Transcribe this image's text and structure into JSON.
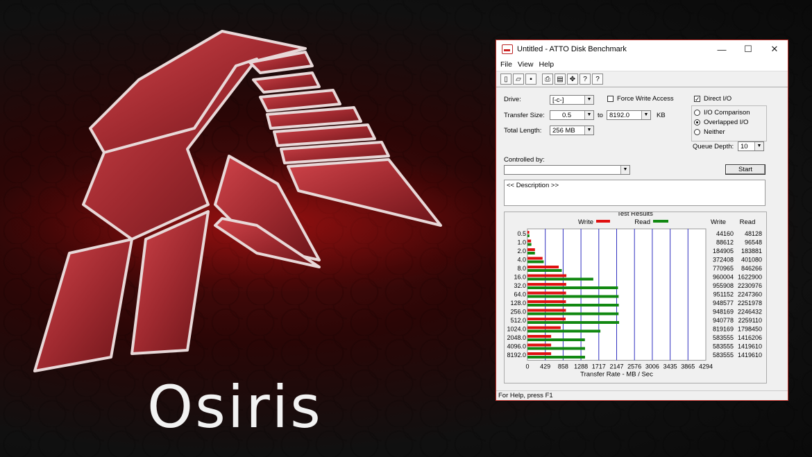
{
  "background": {
    "brand_text": "Osiris",
    "logo": "osiris-helmet-logo",
    "accent_color": "#c9363c"
  },
  "window": {
    "title": "Untitled - ATTO Disk Benchmark",
    "controls": {
      "minimize": "—",
      "maximize": "☐",
      "close": "✕"
    },
    "menu": [
      "File",
      "View",
      "Help"
    ],
    "toolbar_icons": [
      "new-icon",
      "open-icon",
      "save-icon",
      "print-icon",
      "print-preview-icon",
      "move-icon",
      "help-icon",
      "context-help-icon"
    ]
  },
  "settings": {
    "drive_label": "Drive:",
    "drive_value": "[-c-]",
    "force_write_label": "Force Write Access",
    "force_write_checked": false,
    "direct_io_label": "Direct I/O",
    "direct_io_checked": true,
    "transfer_size_label": "Transfer Size:",
    "transfer_from": "0.5",
    "to_label": "to",
    "transfer_to": "8192.0",
    "kb_label": "KB",
    "total_length_label": "Total Length:",
    "total_length_value": "256 MB",
    "io_comparison_label": "I/O Comparison",
    "overlapped_io_label": "Overlapped I/O",
    "neither_label": "Neither",
    "selected_mode": "Overlapped I/O",
    "queue_depth_label": "Queue Depth:",
    "queue_depth_value": "10",
    "controlled_by_label": "Controlled by:",
    "controlled_by_value": "",
    "start_label": "Start",
    "description": "<< Description >>"
  },
  "results": {
    "title": "Test Results",
    "write_label": "Write",
    "read_label": "Read",
    "write_color": "#e01010",
    "read_color": "#118811",
    "col_write": "Write",
    "col_read": "Read",
    "xlabel": "Transfer Rate - MB / Sec",
    "x_ticks": [
      "0",
      "429",
      "858",
      "1288",
      "1717",
      "2147",
      "2576",
      "3006",
      "3435",
      "3865",
      "4294"
    ]
  },
  "chart_data": {
    "type": "bar",
    "orientation": "horizontal",
    "categories": [
      "0.5",
      "1.0",
      "2.0",
      "4.0",
      "8.0",
      "16.0",
      "32.0",
      "64.0",
      "128.0",
      "256.0",
      "512.0",
      "1024.0",
      "2048.0",
      "4096.0",
      "8192.0"
    ],
    "series": [
      {
        "name": "Write",
        "values": [
          44160,
          88612,
          184905,
          372408,
          770965,
          960004,
          955908,
          951152,
          948577,
          948169,
          940778,
          819169,
          583555,
          583555,
          583555
        ]
      },
      {
        "name": "Read",
        "values": [
          48128,
          96548,
          183881,
          401080,
          846266,
          1622900,
          2230976,
          2247360,
          2251978,
          2246432,
          2259110,
          1798450,
          1416206,
          1419610,
          1419610
        ]
      }
    ],
    "xlabel": "Transfer Rate - MB / Sec",
    "xlim": [
      0,
      4294
    ],
    "grid": true
  },
  "statusbar": "For Help, press F1"
}
